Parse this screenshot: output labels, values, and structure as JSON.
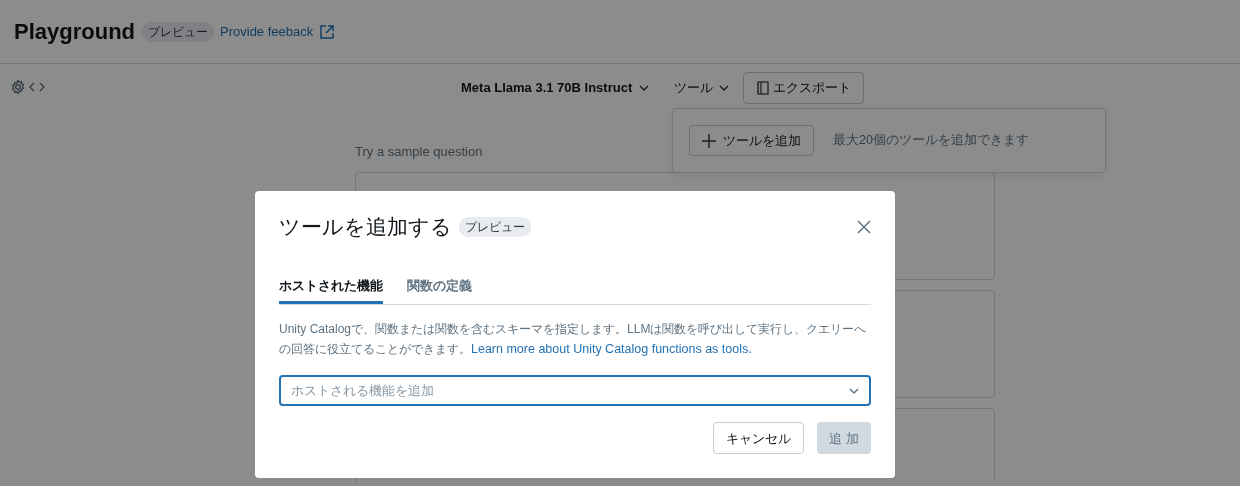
{
  "header": {
    "title": "Playground",
    "badge": "プレビュー",
    "feedback_link": "Provide feeback"
  },
  "toolbar": {
    "model": "Meta Llama 3.1 70B Instruct",
    "tools": "ツール",
    "export": "エクスポート"
  },
  "tools_panel": {
    "add_button": "ツールを追加",
    "hint": "最大20個のツールを追加できます"
  },
  "sample": {
    "label": "Try a sample question"
  },
  "dialog": {
    "title": "ツールを追加する",
    "badge": "プレビュー",
    "tabs": [
      {
        "label": "ホストされた機能",
        "selected": true
      },
      {
        "label": "関数の定義",
        "selected": false
      }
    ],
    "description": "Unity Catalogで、関数または関数を含むスキーマを指定します。LLMは関数を呼び出して実行し、クエリーへの回答に役立てることができます。",
    "link": "Learn more about Unity Catalog functions as tools.",
    "select": {
      "placeholder": "ホストされる機能を追加"
    },
    "buttons": [
      {
        "label": "キャンセル",
        "kind": "secondary"
      },
      {
        "label": "追 加",
        "kind": "primary",
        "disabled": true
      }
    ]
  }
}
